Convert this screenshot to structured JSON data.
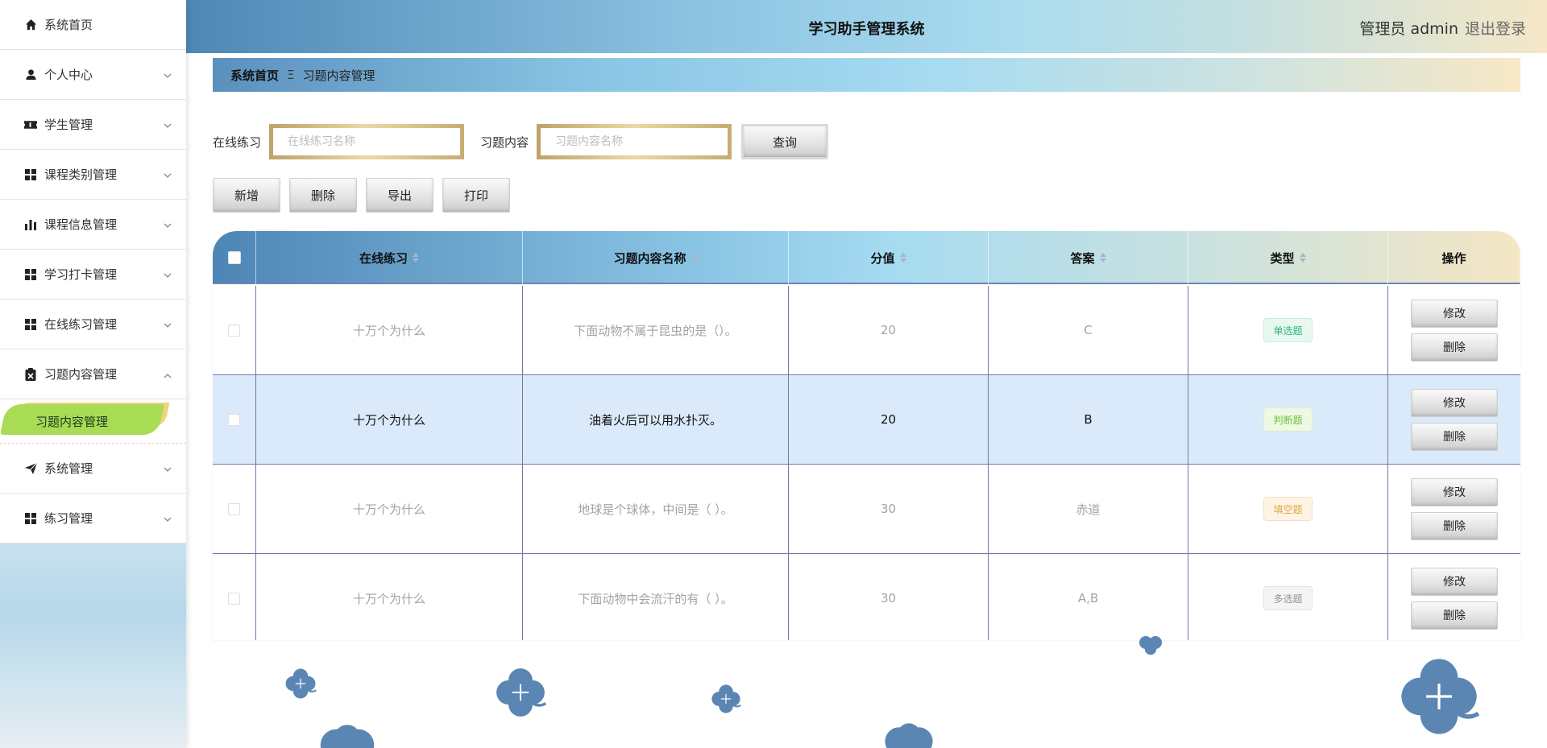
{
  "sidebar": {
    "items": [
      {
        "label": "系统首页",
        "icon": "home-icon"
      },
      {
        "label": "个人中心",
        "icon": "user-icon"
      },
      {
        "label": "学生管理",
        "icon": "ticket-icon"
      },
      {
        "label": "课程类别管理",
        "icon": "grid-icon"
      },
      {
        "label": "课程信息管理",
        "icon": "bar-chart-icon"
      },
      {
        "label": "学习打卡管理",
        "icon": "grid-icon"
      },
      {
        "label": "在线练习管理",
        "icon": "grid-icon"
      },
      {
        "label": "习题内容管理",
        "icon": "clipboard-icon"
      },
      {
        "label": "系统管理",
        "icon": "send-icon"
      },
      {
        "label": "练习管理",
        "icon": "grid-icon"
      }
    ],
    "active_sub": "习题内容管理"
  },
  "header": {
    "title": "学习助手管理系统",
    "user": "管理员 admin",
    "logout": "退出登录"
  },
  "breadcrumb": {
    "home": "系统首页",
    "separator": "Ξ",
    "current": "习题内容管理"
  },
  "search": {
    "practice_label": "在线练习",
    "practice_placeholder": "在线练习名称",
    "content_label": "习题内容",
    "content_placeholder": "习题内容名称",
    "query_button": "查询"
  },
  "actions": {
    "add": "新增",
    "delete": "删除",
    "export": "导出",
    "print": "打印"
  },
  "table": {
    "headers": [
      "在线练习",
      "习题内容名称",
      "分值",
      "答案",
      "类型",
      "操作"
    ],
    "rows": [
      {
        "practice": "十万个为什么",
        "content": "下面动物不属于昆虫的是（）。",
        "score": "20",
        "answer": "C",
        "type": "单选题",
        "type_color": "green"
      },
      {
        "practice": "十万个为什么",
        "content": "油着火后可以用水扑灭。",
        "score": "20",
        "answer": "B",
        "type": "判断题",
        "type_color": "lime"
      },
      {
        "practice": "十万个为什么",
        "content": "地球是个球体，中间是（ ）。",
        "score": "30",
        "answer": "赤道",
        "type": "填空题",
        "type_color": "orange"
      },
      {
        "practice": "十万个为什么",
        "content": "下面动物中会流汗的有（ ）。",
        "score": "30",
        "answer": "A,B",
        "type": "多选题",
        "type_color": "gray"
      }
    ],
    "edit_label": "修改",
    "delete_label": "删除"
  },
  "colors": {
    "accent_blue": "#4f87b6",
    "sky": "#a9dbef",
    "sand": "#f5e7c6",
    "highlight_row": "#dbeafb",
    "active_submenu": "#a8dc55",
    "clover": "#5b86b3"
  }
}
